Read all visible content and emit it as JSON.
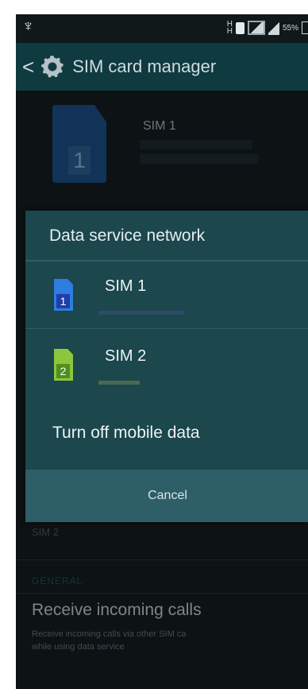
{
  "status_bar": {
    "usb_icon": "usb-icon",
    "battery_text": "55%"
  },
  "action_bar": {
    "back_glyph": "<",
    "title": "SIM card manager"
  },
  "sim1_card": {
    "number": "1",
    "name": "SIM 1"
  },
  "dialog": {
    "title": "Data service network",
    "options": [
      {
        "label": "SIM 1",
        "icon_number": "1",
        "icon_color": "#2f7de0"
      },
      {
        "label": "SIM 2",
        "icon_number": "2",
        "icon_color": "#8cc63e"
      }
    ],
    "turn_off_label": "Turn off mobile data",
    "cancel_label": "Cancel"
  },
  "background": {
    "sim2_label": "SIM 2",
    "general_header": "GENERAL",
    "receive_calls_title": "Receive incoming calls",
    "receive_calls_subtitle_line1": "Receive incoming calls via other SIM ca",
    "receive_calls_subtitle_line2": "while using data service"
  },
  "colors": {
    "action_bar": "#0f3a40",
    "dialog": "#1b474d",
    "cancel_area": "#2e5e66",
    "background": "#141d20"
  }
}
